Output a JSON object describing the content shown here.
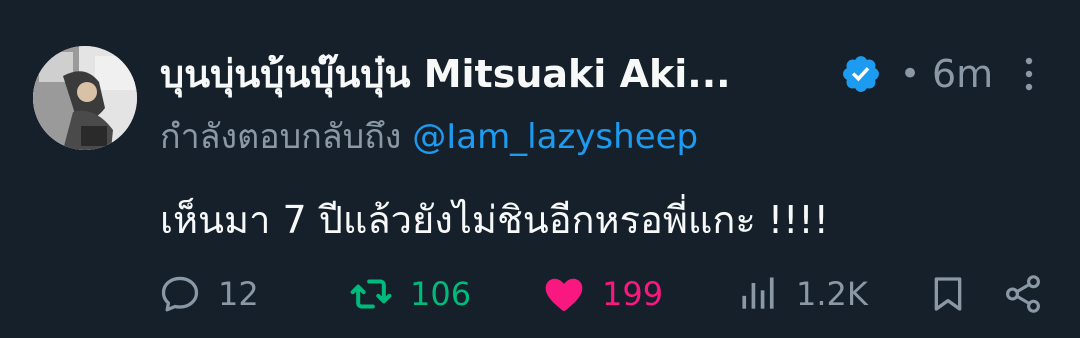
{
  "tweet": {
    "display_name": "บุนบุ่นบุ้นบุ๊นบุ๋น Mitsuaki Aki...",
    "verified_icon": "verified-badge-icon",
    "separator": "•",
    "timestamp": "6m",
    "reply_prefix": "กำลังตอบกลับถึง ",
    "reply_to": "@Iam_lazysheep",
    "text": "เห็นมา 7 ปีแล้วยังไม่ชินอีกหรอพี่แกะ !!!!"
  },
  "actions": {
    "reply": {
      "icon": "comment-icon",
      "count": "12"
    },
    "retweet": {
      "icon": "retweet-icon",
      "count": "106",
      "active": true,
      "color": "#00ba7c"
    },
    "like": {
      "icon": "heart-icon",
      "count": "199",
      "active": true,
      "color": "#f91880"
    },
    "views": {
      "icon": "views-bar-chart-icon",
      "count": "1.2K"
    },
    "bookmark": {
      "icon": "bookmark-icon"
    },
    "share": {
      "icon": "share-icon"
    }
  },
  "colors": {
    "background": "#15202b",
    "primary_text": "#f7f9f9",
    "secondary_text": "#8b98a5",
    "link": "#1d9bf0",
    "verified": "#1d9bf0"
  }
}
